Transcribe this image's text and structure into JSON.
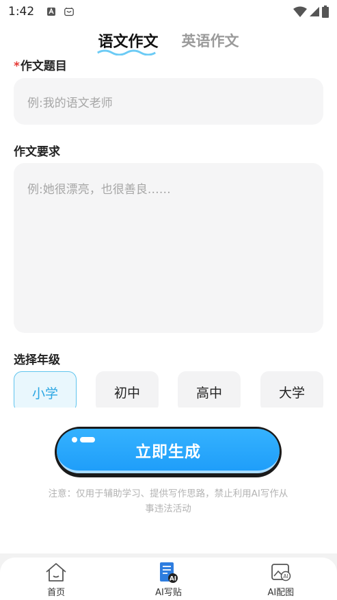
{
  "status": {
    "time": "1:42"
  },
  "tabs": [
    {
      "label": "语文作文",
      "active": true
    },
    {
      "label": "英语作文",
      "active": false
    }
  ],
  "form": {
    "title_label": "作文题目",
    "title_required_mark": "*",
    "title_placeholder": "例:我的语文老师",
    "requirement_label": "作文要求",
    "requirement_placeholder": "例:她很漂亮，也很善良……",
    "grade_label": "选择年级",
    "grades": [
      {
        "label": "小学",
        "selected": true
      },
      {
        "label": "初中",
        "selected": false
      },
      {
        "label": "高中",
        "selected": false
      },
      {
        "label": "大学",
        "selected": false
      }
    ]
  },
  "generate_button": "立即生成",
  "notice": "注意：仅用于辅助学习、提供写作思路，禁止利用AI写作从事违法活动",
  "bottom_nav": [
    {
      "label": "首页",
      "icon": "home-icon"
    },
    {
      "label": "AI写贴",
      "icon": "ai-write-icon"
    },
    {
      "label": "AI配图",
      "icon": "ai-image-icon"
    }
  ],
  "colors": {
    "accent": "#2aa6e3",
    "button": "#1f9ef9",
    "required": "#e53935"
  }
}
